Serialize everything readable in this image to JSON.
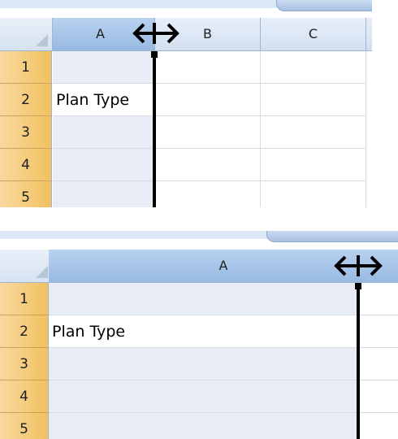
{
  "top": {
    "columns": [
      "A",
      "B",
      "C"
    ],
    "rows": [
      "1",
      "2",
      "3",
      "4",
      "5"
    ],
    "cell_A2": "Plan Type"
  },
  "bottom": {
    "columns": [
      "A"
    ],
    "rows": [
      "1",
      "2",
      "3",
      "4",
      "5"
    ],
    "cell_A2": "Plan Type"
  },
  "icons": {
    "resize_cursor": "column-resize-cursor-icon",
    "select_all": "select-all-triangle-icon"
  }
}
